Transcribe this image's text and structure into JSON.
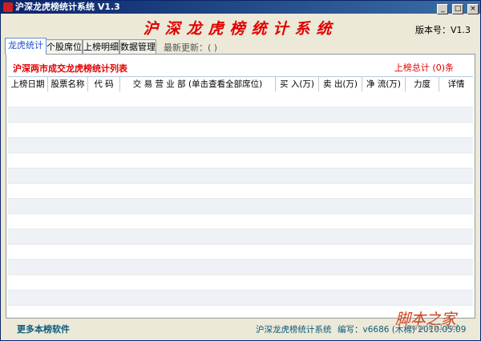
{
  "window": {
    "title": "沪深龙虎榜统计系统 V1.3"
  },
  "titlebar_buttons": {
    "minimize": "_",
    "maximize": "□",
    "close": "×"
  },
  "banner": {
    "title": "沪深龙虎榜统计系统",
    "version": "版本号：V1.3"
  },
  "tabs": [
    {
      "label": "龙虎统计",
      "active": true
    },
    {
      "label": "个股席位",
      "active": false
    },
    {
      "label": "上榜明细",
      "active": false
    },
    {
      "label": "数据管理",
      "active": false
    }
  ],
  "last_update": "最新更新：( )",
  "panel": {
    "list_title": "沪深两市成交龙虎榜统计列表",
    "total": "上榜总计 (0)条"
  },
  "table": {
    "columns": [
      "上榜日期",
      "股票名称",
      "代 码",
      "交 易 营 业 部 (单击查看全部席位)",
      "买 入(万)",
      "卖 出(万)",
      "净 流(万)",
      "力度",
      "详情"
    ],
    "rows": []
  },
  "footer": {
    "more_software": "更多本榜软件",
    "app_name": "沪深龙虎榜统计系统",
    "author": "编写：v6686 (木棉) 2010.05.09"
  },
  "watermark": {
    "text": "脚本之家",
    "url": "www.jb51.net"
  },
  "colors": {
    "accent": "#e00000",
    "tab_active": "#1f4ec8",
    "footer": "#0b5a7a"
  }
}
